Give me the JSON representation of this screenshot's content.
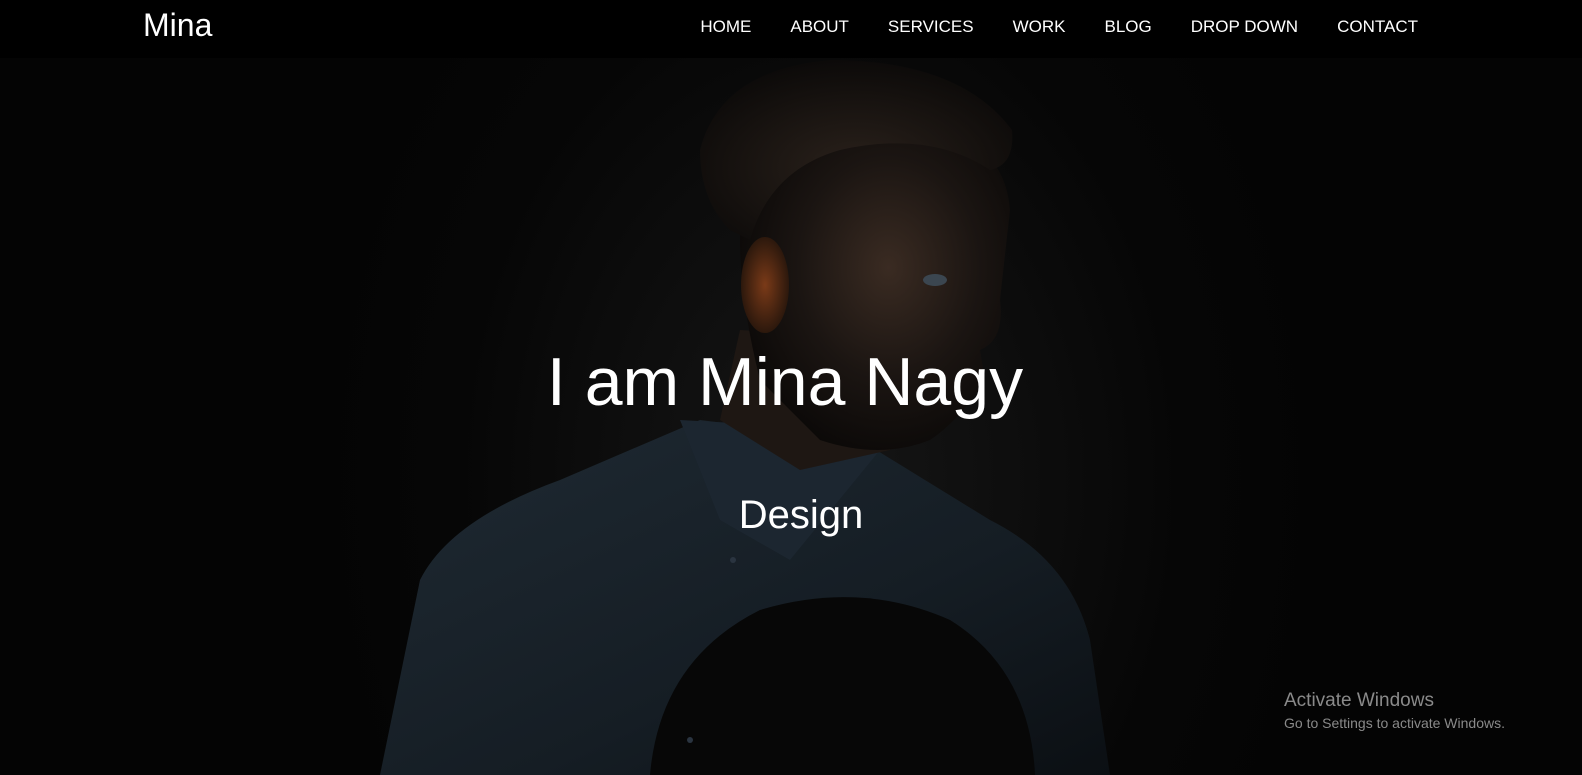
{
  "navbar": {
    "brand": "Mina",
    "links": [
      "HOME",
      "ABOUT",
      "SERVICES",
      "WORK",
      "BLOG",
      "DROP DOWN",
      "CONTACT"
    ]
  },
  "hero": {
    "title": "I am Mina Nagy",
    "subtitle": "Design"
  },
  "watermark": {
    "title": "Activate Windows",
    "subtitle": "Go to Settings to activate Windows."
  },
  "colors": {
    "navbar_background": "#000000",
    "page_background": "#050505",
    "text": "#ffffff",
    "watermark_text": "#8a8a8a"
  }
}
